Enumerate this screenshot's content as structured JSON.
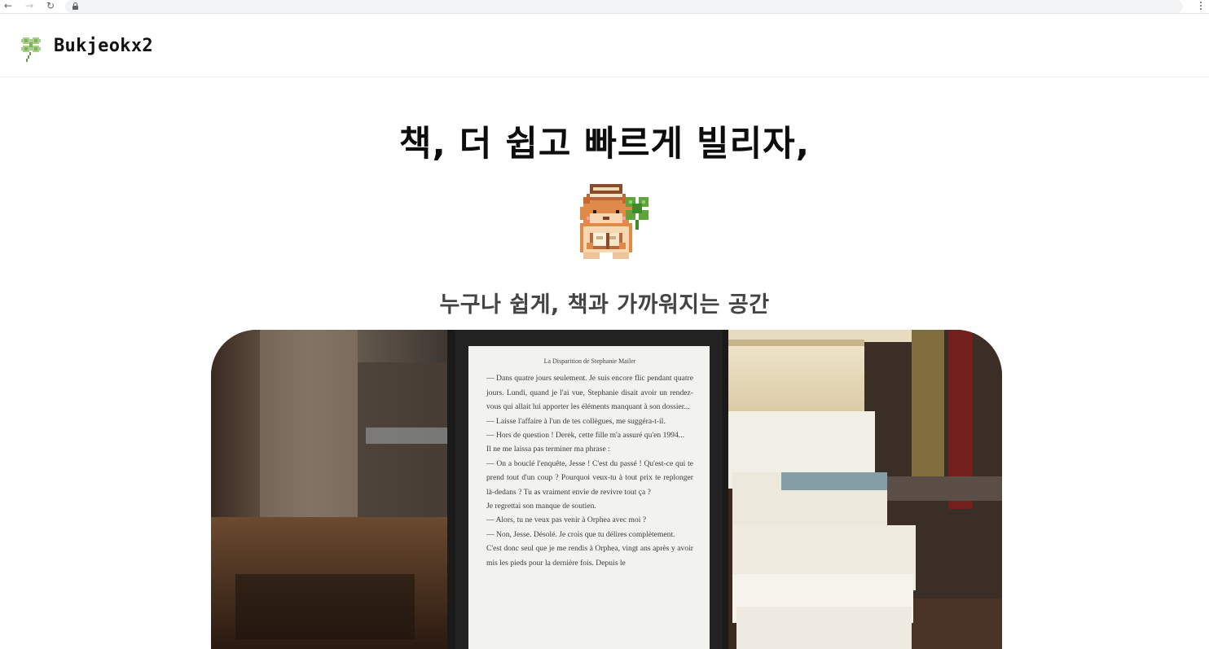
{
  "browser": {
    "back_icon": "arrow-left-icon",
    "forward_icon": "arrow-right-icon",
    "reload_icon": "reload-icon",
    "lock_icon": "lock-icon",
    "menu_icon": "kebab-menu-icon",
    "back_glyph": "←",
    "forward_glyph": "→",
    "reload_glyph": "↻"
  },
  "header": {
    "logo_icon": "clover-icon",
    "brand": "Bukjeokx2"
  },
  "hero": {
    "title": "책, 더 쉽고 빠르게 빌리자,",
    "mascot_icon": "hamster-reading-book-icon",
    "subtitle": "누구나 쉽게, 책과 가까워지는 공간"
  },
  "photo": {
    "ereader_heading": "La Disparition de Stephanie Mailer",
    "ereader_lines": [
      "— Dans quatre jours seulement. Je suis encore flic pendant quatre jours. Lundi, quand je l'ai vue, Stephanie disait avoir un rendez-vous qui allait lui apporter les éléments manquant à son dossier...",
      "— Laisse l'affaire à l'un de tes collègues, me suggéra-t-il.",
      "— Hors de question ! Derek, cette fille m'a assuré qu'en 1994...",
      "Il ne me laissa pas terminer ma phrase :",
      "— On a bouclé l'enquête, Jesse ! C'est du passé ! Qu'est-ce qui te prend tout d'un coup ? Pourquoi veux-tu à tout prix te replonger là-dedans ? Tu as vraiment envie de revivre tout ça ?",
      "Je regrettai son manque de soutien.",
      "— Alors, tu ne veux pas venir à Orphea avec moi ?",
      "— Non, Jesse. Désolé. Je crois que tu délires complètement.",
      "C'est donc seul que je me rendis à Orphea, vingt ans après y avoir mis les pieds pour la dernière fois. Depuis le"
    ]
  },
  "colors": {
    "page_bg": "#ffffff",
    "title_text": "#0d0d0d",
    "subtitle_text": "#444444",
    "clover_green": "#8fbf6a",
    "hamster_orange": "#e08a4a"
  }
}
